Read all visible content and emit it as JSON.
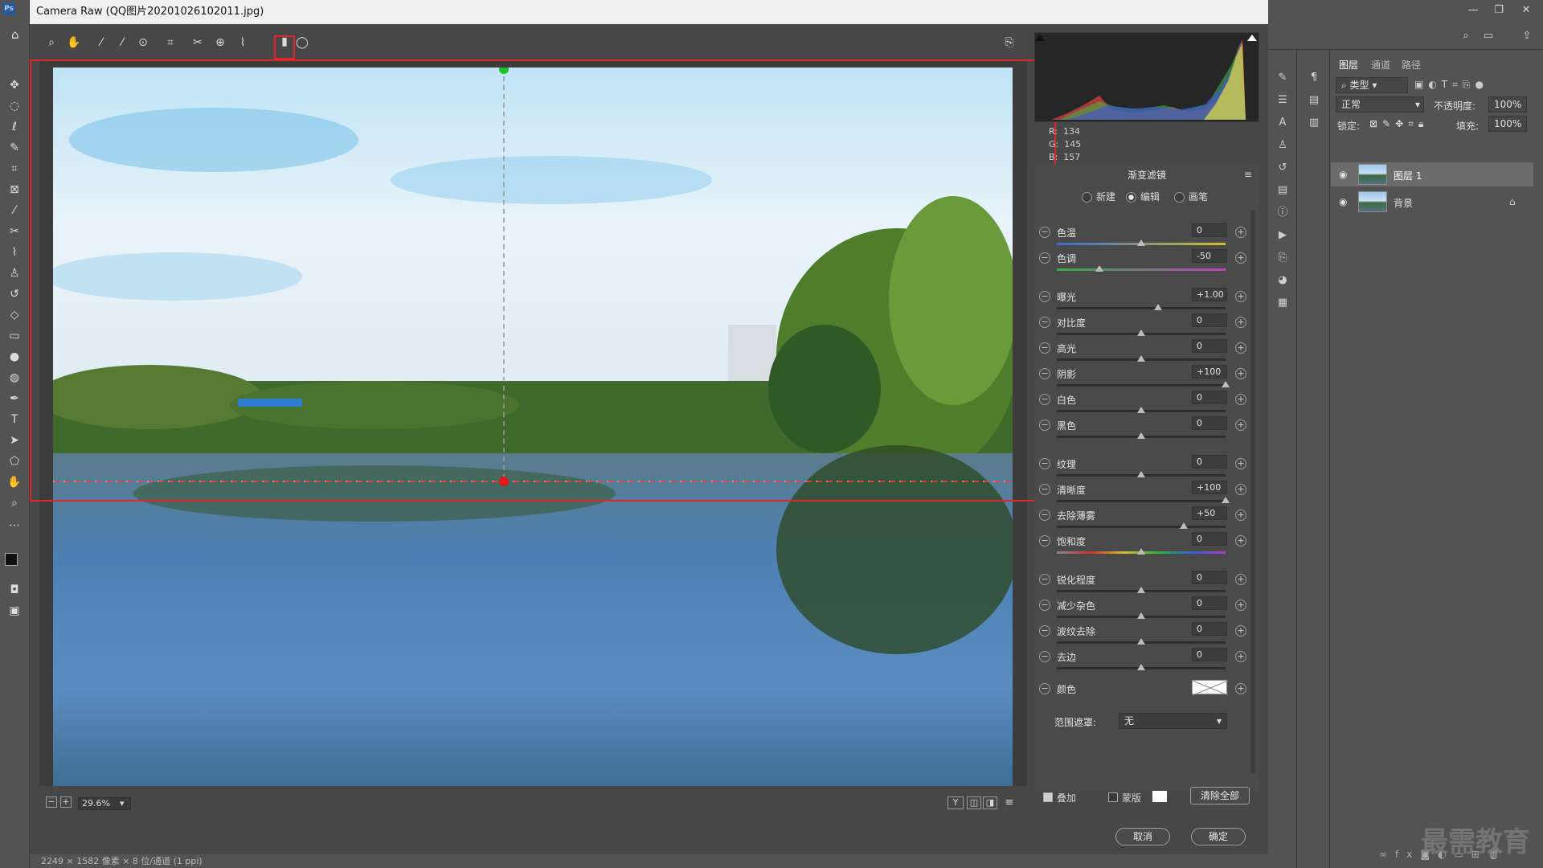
{
  "app": {
    "logo": "Ps",
    "dialog_title": "Camera Raw (QQ图片20201026102011.jpg)"
  },
  "toolbar": {
    "icons": [
      "zoom-icon",
      "hand-icon",
      "white-balance-icon",
      "color-sampler-icon",
      "targeted-adjust-icon",
      "transform-icon",
      "spot-removal-icon",
      "redeye-icon",
      "adjustment-brush-icon",
      "graduated-filter-icon",
      "radial-filter-icon",
      "preferences-icon"
    ]
  },
  "zoom": {
    "value": "29.6%",
    "minus": "−",
    "plus": "+",
    "dropdown": "▾"
  },
  "preview_buttons": [
    "Y",
    "◫",
    "◨",
    "≡"
  ],
  "rgb": {
    "r_label": "R:",
    "r": "134",
    "g_label": "G:",
    "g": "145",
    "b_label": "B:",
    "b": "157"
  },
  "panel": {
    "title": "渐变滤镜",
    "menu": "≡",
    "modes": {
      "new": "新建",
      "edit": "编辑",
      "brush": "画笔",
      "selected": "edit"
    },
    "sliders": [
      {
        "label": "色温",
        "value": "0",
        "level": 0.5
      },
      {
        "label": "色调",
        "value": "-50",
        "level": 0.25
      },
      {
        "label": "曝光",
        "value": "+1.00",
        "level": 0.6
      },
      {
        "label": "对比度",
        "value": "0",
        "level": 0.5
      },
      {
        "label": "高光",
        "value": "0",
        "level": 0.5
      },
      {
        "label": "阴影",
        "value": "+100",
        "level": 1.0
      },
      {
        "label": "白色",
        "value": "0",
        "level": 0.5
      },
      {
        "label": "黑色",
        "value": "0",
        "level": 0.5
      },
      {
        "label": "纹理",
        "value": "0",
        "level": 0.5
      },
      {
        "label": "清晰度",
        "value": "+100",
        "level": 1.0
      },
      {
        "label": "去除薄雾",
        "value": "+50",
        "level": 0.75
      },
      {
        "label": "饱和度",
        "value": "0",
        "level": 0.5
      },
      {
        "label": "锐化程度",
        "value": "0",
        "level": 0.5
      },
      {
        "label": "减少杂色",
        "value": "0",
        "level": 0.5
      },
      {
        "label": "波纹去除",
        "value": "0",
        "level": 0.5
      },
      {
        "label": "去边",
        "value": "0",
        "level": 0.5
      }
    ],
    "color_label": "颜色",
    "range_mask_label": "范围遮罩:",
    "range_mask_value": "无",
    "overlay_label": "叠加",
    "mask_label": "蒙版",
    "clear_all": "清除全部"
  },
  "dialog_buttons": {
    "cancel": "取消",
    "ok": "确定"
  },
  "layers_panel": {
    "tabs": [
      "图层",
      "通道",
      "路径"
    ],
    "filter": "类型",
    "blend_mode": "正常",
    "opacity_label": "不透明度:",
    "opacity": "100%",
    "lock_label": "锁定:",
    "fill_label": "填充:",
    "fill": "100%",
    "layers": [
      {
        "name": "图层 1",
        "selected": true
      },
      {
        "name": "背景",
        "selected": false
      }
    ]
  },
  "status": "2249 × 1582 像素 × 8 位/通道 (1 ppi)",
  "watermark": "最需教育"
}
